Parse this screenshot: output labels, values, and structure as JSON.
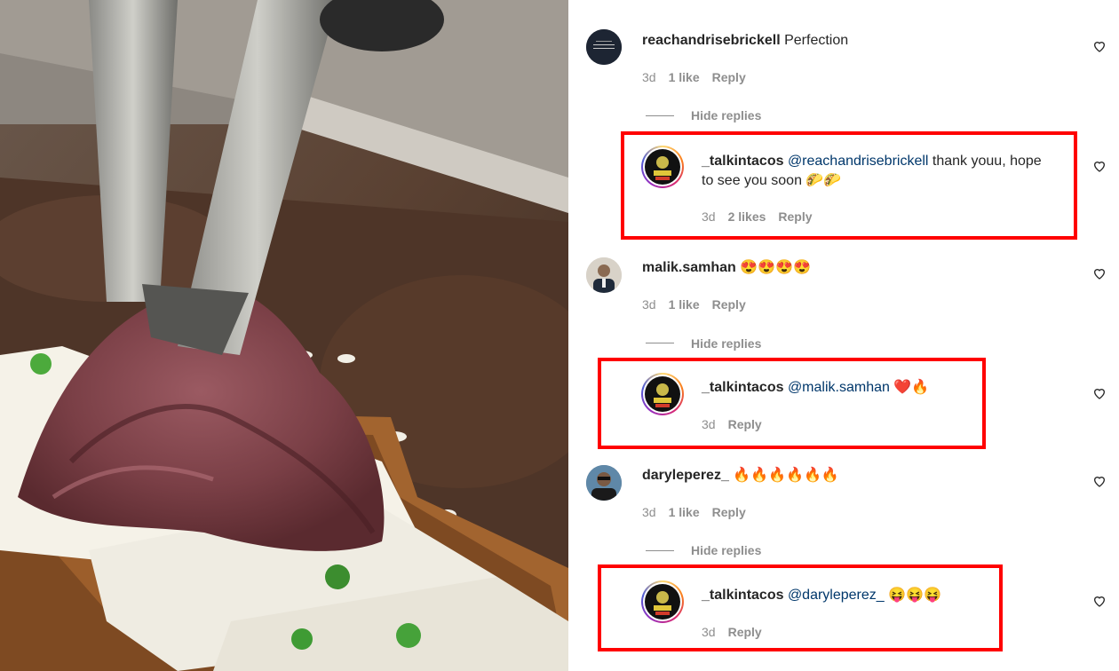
{
  "comments": [
    {
      "username": "reachandrisebrickell",
      "text": "Perfection",
      "time": "3d",
      "likes": "1 like",
      "reply_label": "Reply",
      "hide_label": "Hide replies",
      "avatar": "signature-residences-logo-icon",
      "reply": {
        "username": "_talkintacos",
        "mention": "@reachandrisebrickell",
        "text_line1": " thank youu, hope",
        "text_line2": "to see you soon 🌮🌮",
        "time": "3d",
        "likes": "2 likes",
        "reply_label": "Reply"
      }
    },
    {
      "username": "malik.samhan",
      "text": "😍😍😍😍",
      "time": "3d",
      "likes": "1 like",
      "reply_label": "Reply",
      "hide_label": "Hide replies",
      "avatar": "man-in-suit-avatar",
      "reply": {
        "username": "_talkintacos",
        "mention": "@malik.samhan",
        "text": " ❤️🔥",
        "time": "3d",
        "reply_label": "Reply"
      }
    },
    {
      "username": "daryleperez_",
      "text": "🔥🔥🔥🔥🔥🔥",
      "time": "3d",
      "likes": "1 like",
      "reply_label": "Reply",
      "hide_label": "Hide replies",
      "avatar": "man-with-sunglasses-avatar",
      "reply": {
        "username": "_talkintacos",
        "mention": "@daryleperez_",
        "text": " 😝😝😝",
        "time": "3d",
        "reply_label": "Reply"
      }
    }
  ],
  "colors": {
    "highlight_box": "#ff0000",
    "mention": "#00376b",
    "meta": "#8e8e8e"
  },
  "media": {
    "description_icon": "brisket-toast-on-griddle-video"
  }
}
